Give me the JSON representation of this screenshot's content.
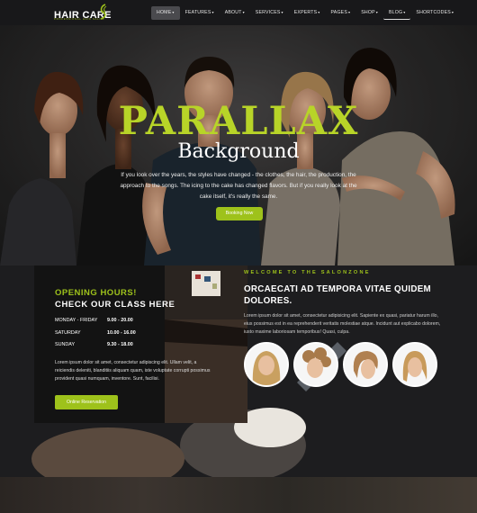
{
  "nav": {
    "logo": "HAIR CARE",
    "logo_sub": "PROFESSIONAL HAIR SALON",
    "items": [
      {
        "label": "HOME"
      },
      {
        "label": "FEATURES"
      },
      {
        "label": "ABOUT"
      },
      {
        "label": "SERVICES"
      },
      {
        "label": "EXPERTS"
      },
      {
        "label": "PAGES"
      },
      {
        "label": "SHOP"
      },
      {
        "label": "BLOG"
      },
      {
        "label": "SHORTCODES"
      }
    ]
  },
  "hero": {
    "title": "PARALLAX",
    "subtitle": "Background",
    "text": "If you look over the years, the styles have changed - the clothes, the hair, the production, the approach to the songs. The icing to the cake has changed flavors. But if you really look at the cake itself, it's really the same.",
    "button": "Booking Now"
  },
  "hours": {
    "title": "OPENING HOURS!",
    "subtitle": "CHECK OUR CLASS HERE",
    "rows": [
      {
        "day": "MONDAY - FRIDAY",
        "time": "9.00 - 20.00"
      },
      {
        "day": "SATURDAY",
        "time": "10.00 - 16.00"
      },
      {
        "day": "SUNDAY",
        "time": "9.30 - 18.00"
      }
    ],
    "text": "Lorem ipsum dolor sit amet, consectetur adipiscing elit. Ullam velit, a reiciendis deleniti, blanditiis aliquam quam, iste voluptate corrupti possimus provident quasi numquam, inventore. Sunt, facilisi.",
    "button": "Online Reservation"
  },
  "salon": {
    "welcome": "WELCOME TO THE SALONZONE",
    "title": "ORCAECATI AD TEMPORA VITAE QUIDEM DOLORES.",
    "text": "Lorem ipsum dolor sit amet, consectetur adipisicing elit. Sapiente ex quasi, pariatur harum illo, eius possimus est in ea reprehenderit veritatis molestiae atque. Incidunt aut explicabo dolorem, iusto maxime laboriosam temporibus! Quasi, culpa."
  },
  "colors": {
    "accent": "#9ec21b",
    "nav_bg": "#18181a"
  }
}
